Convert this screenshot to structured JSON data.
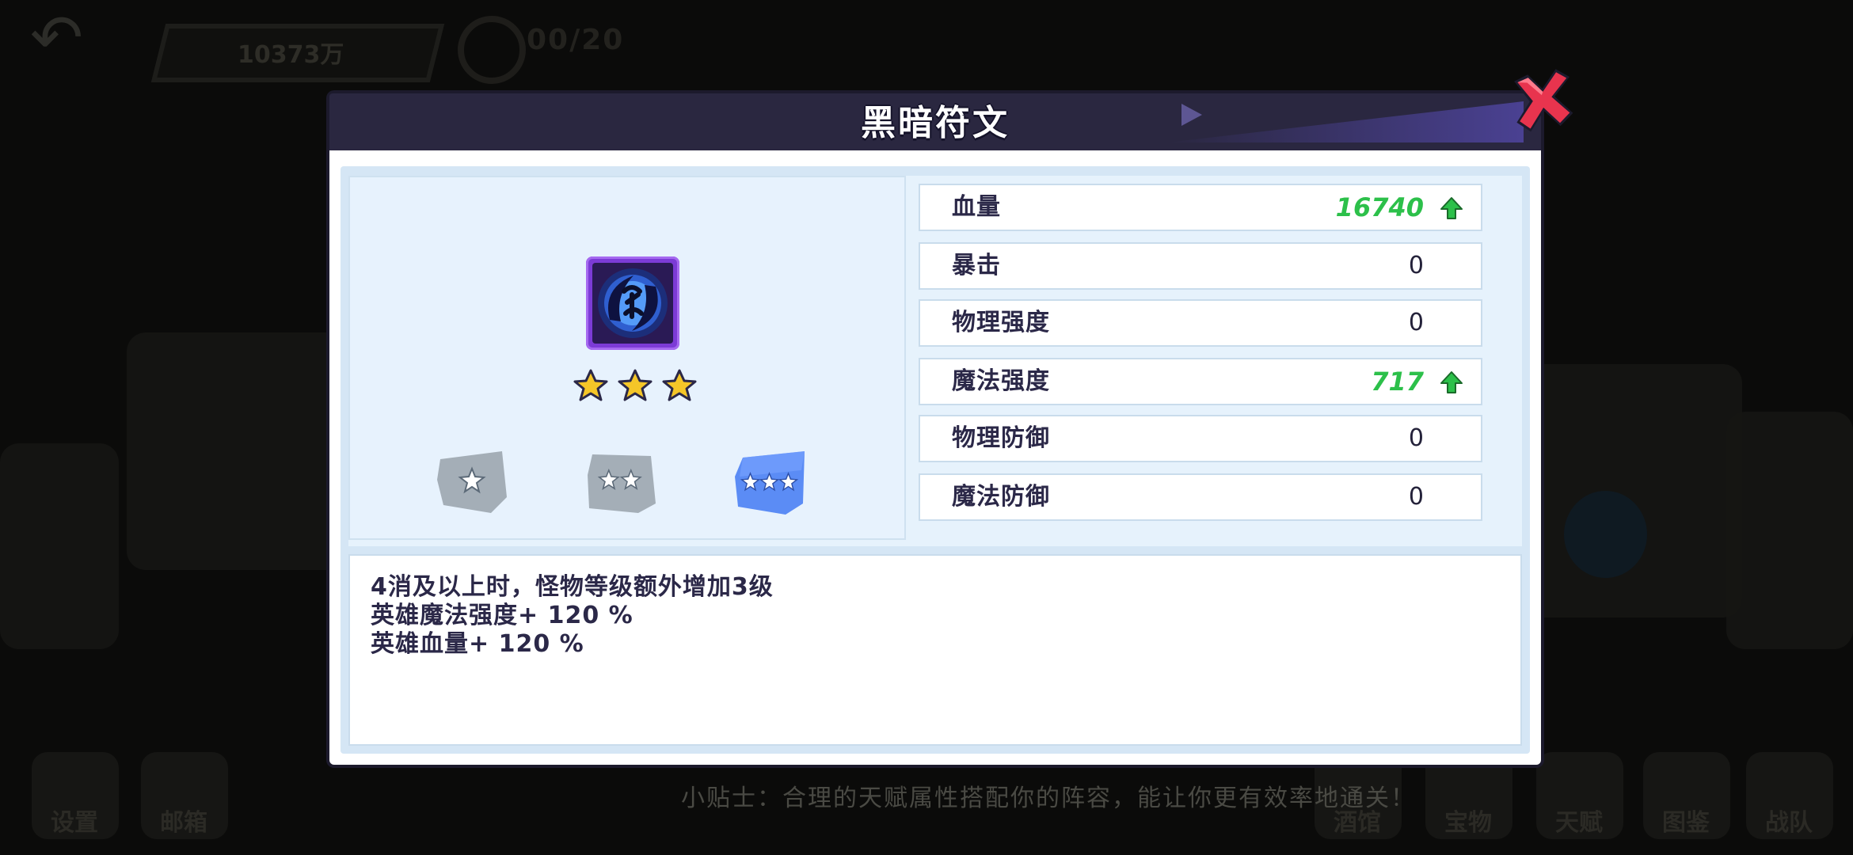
{
  "background": {
    "currency_text": "10373万",
    "counter_text": "00/20",
    "tip_text": "小贴士：合理的天赋属性搭配你的阵容，能让你更有效率地通关！",
    "nav_items": [
      {
        "label": "设置",
        "icon": "settings-icon"
      },
      {
        "label": "邮箱",
        "icon": "mail-icon"
      },
      {
        "label": "酒馆",
        "icon": "tavern-icon"
      },
      {
        "label": "宝物",
        "icon": "treasure-icon"
      },
      {
        "label": "天赋",
        "icon": "talent-icon"
      },
      {
        "label": "图鉴",
        "icon": "codex-icon"
      },
      {
        "label": "战队",
        "icon": "team-icon"
      }
    ]
  },
  "modal": {
    "title": "黑暗符文",
    "close_icon": "close-x-icon",
    "rune_icon": "dark-rune-icon",
    "star_count": 3,
    "star_color": "#f5c628",
    "quality_tiers": [
      {
        "stars": 1,
        "selected": false
      },
      {
        "stars": 2,
        "selected": false
      },
      {
        "stars": 3,
        "selected": true
      }
    ],
    "stats": [
      {
        "name": "血量",
        "value": "16740",
        "increased": true
      },
      {
        "name": "暴击",
        "value": "0",
        "increased": false
      },
      {
        "name": "物理强度",
        "value": "0",
        "increased": false
      },
      {
        "name": "魔法强度",
        "value": "717",
        "increased": true
      },
      {
        "name": "物理防御",
        "value": "0",
        "increased": false
      },
      {
        "name": "魔法防御",
        "value": "0",
        "increased": false
      }
    ],
    "description": [
      "4消及以上时，怪物等级额外增加3级",
      "英雄魔法强度+ 120 %",
      "英雄血量+ 120 %"
    ],
    "colors": {
      "increase_green": "#2cc04a",
      "header_bg": "#2a2740",
      "close_red": "#e8344e"
    }
  }
}
